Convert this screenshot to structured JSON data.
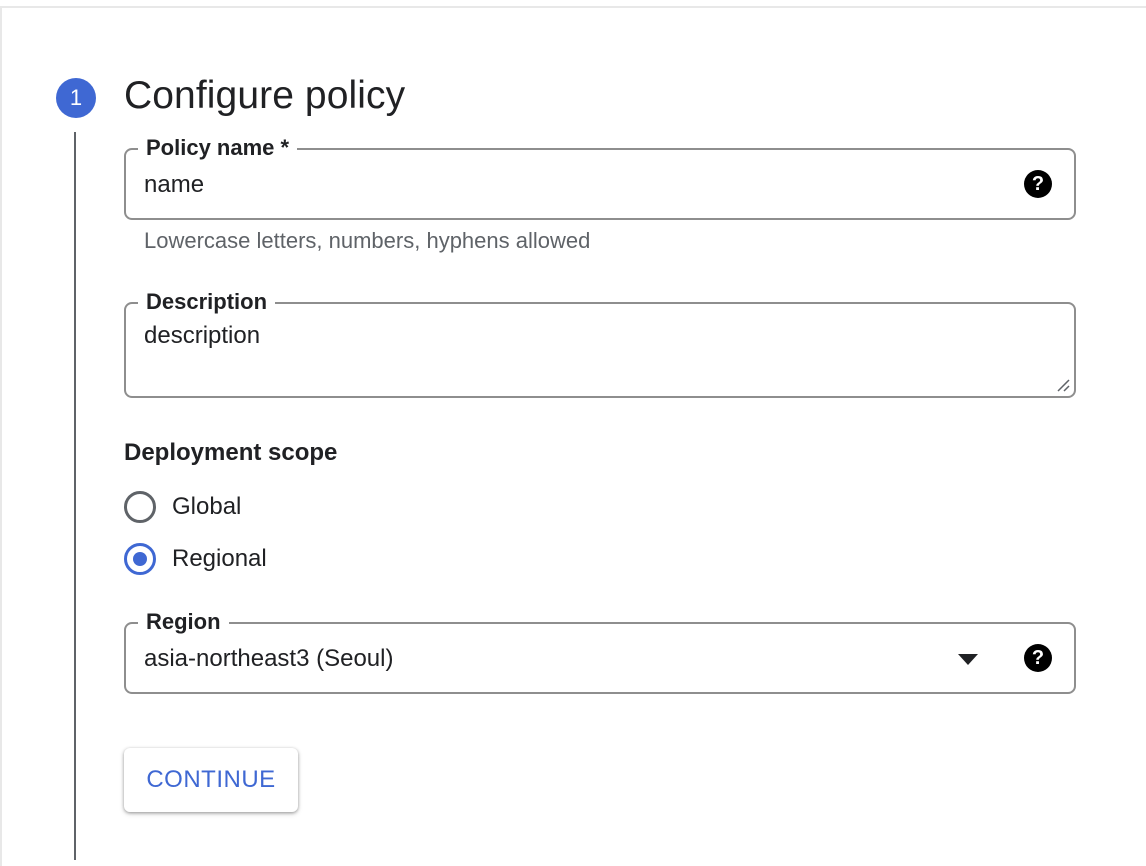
{
  "step": {
    "number": "1",
    "title": "Configure policy",
    "accent_color": "#3f68d3"
  },
  "policy_name": {
    "label": "Policy name *",
    "value": "name",
    "hint": "Lowercase letters, numbers, hyphens allowed",
    "help_icon": "help-circle-icon"
  },
  "description": {
    "label": "Description",
    "value": "description"
  },
  "deployment_scope": {
    "label": "Deployment scope",
    "options": [
      {
        "label": "Global",
        "checked": false
      },
      {
        "label": "Regional",
        "checked": true
      }
    ]
  },
  "region": {
    "label": "Region",
    "value": "asia-northeast3 (Seoul)",
    "dropdown_icon": "arrow-drop-down-icon",
    "help_icon": "help-circle-icon"
  },
  "actions": {
    "continue_label": "CONTINUE"
  }
}
